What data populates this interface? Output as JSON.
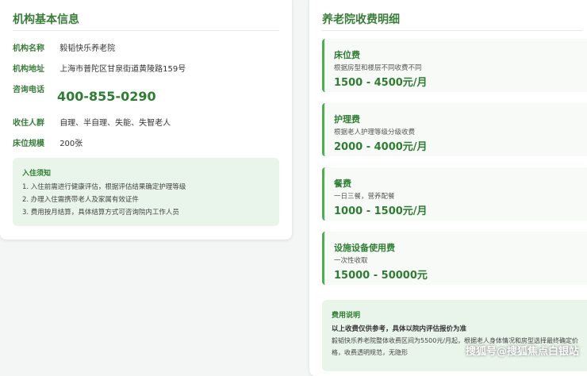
{
  "institution": {
    "section_title": "机构基本信息",
    "rows": [
      {
        "label": "机构名称",
        "value": "毅韬快乐养老院"
      },
      {
        "label": "机构地址",
        "value": "上海市普陀区甘泉街道黄陵路159号"
      },
      {
        "label": "咨询电话",
        "value": "400-855-0290"
      },
      {
        "label": "收住人群",
        "value": "自理、半自理、失能、失智老人"
      },
      {
        "label": "床位规模",
        "value": "200张"
      }
    ],
    "notice": {
      "title": "入住须知",
      "items": [
        "1. 入住前需进行健康评估，根据评估结果确定护理等级",
        "2. 办理入住需携带老人及家属有效证件",
        "3. 费用按月结算，具体结算方式可咨询院内工作人员"
      ]
    }
  },
  "fees": {
    "section_title": "养老院收费明细",
    "items": [
      {
        "name": "床位费",
        "desc": "根据房型和楼层不同收费不同",
        "price": "1500 - 4500元/月"
      },
      {
        "name": "护理费",
        "desc": "根据老人护理等级分级收费",
        "price": "2000 - 4000元/月"
      },
      {
        "name": "餐费",
        "desc": "一日三餐，营养配餐",
        "price": "1000 - 1500元/月"
      },
      {
        "name": "设施设备使用费",
        "desc": "一次性收取",
        "price": "15000 - 50000元"
      }
    ],
    "explanation": {
      "title": "费用说明",
      "bold": "以上收费仅供参考，具体以院内评估报价为准",
      "text": "毅韬快乐养老院整体收费区间为5500元/月起，根据老人身体情况和房型选择最终确定价格，收费透明规范，无隐形"
    }
  },
  "watermark": "搜狐号@搜狐焦点白银站",
  "colors": {
    "accent": "#2f7d32",
    "accent_light": "#e9f5ea",
    "border_accent": "#4caf50"
  }
}
